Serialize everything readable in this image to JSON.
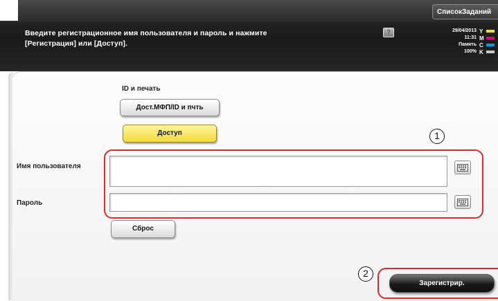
{
  "header": {
    "job_list_label": "СписокЗаданий",
    "instruction_line1": "Введите регистрационное имя пользователя и пароль и нажмите",
    "instruction_line2": "[Регистрация] или [Доступ].",
    "help_icon": "?",
    "status_date": "29/04/2013",
    "status_time": "11:31",
    "status_memory_label": "Память",
    "status_memory_value": "100%",
    "toner": [
      {
        "letter": "Y",
        "color": "#f2e600"
      },
      {
        "letter": "M",
        "color": "#e0007a"
      },
      {
        "letter": "C",
        "color": "#00a0e9"
      },
      {
        "letter": "K",
        "color": "#c8c8c8"
      }
    ]
  },
  "auth": {
    "section_label": "ID и печать",
    "id_print_button": "Дост.МФП/ID и пчть",
    "access_button": "Доступ",
    "username_label": "Имя пользователя",
    "username_value": "",
    "password_label": "Пароль",
    "password_value": "",
    "reset_button": "Сброс",
    "register_button": "Зарегистрир."
  },
  "callouts": {
    "one": "1",
    "two": "2"
  },
  "colors": {
    "callout_red": "#e02a2a",
    "access_yellow": "#f1da3a",
    "header_dark": "#1a1a1a"
  }
}
